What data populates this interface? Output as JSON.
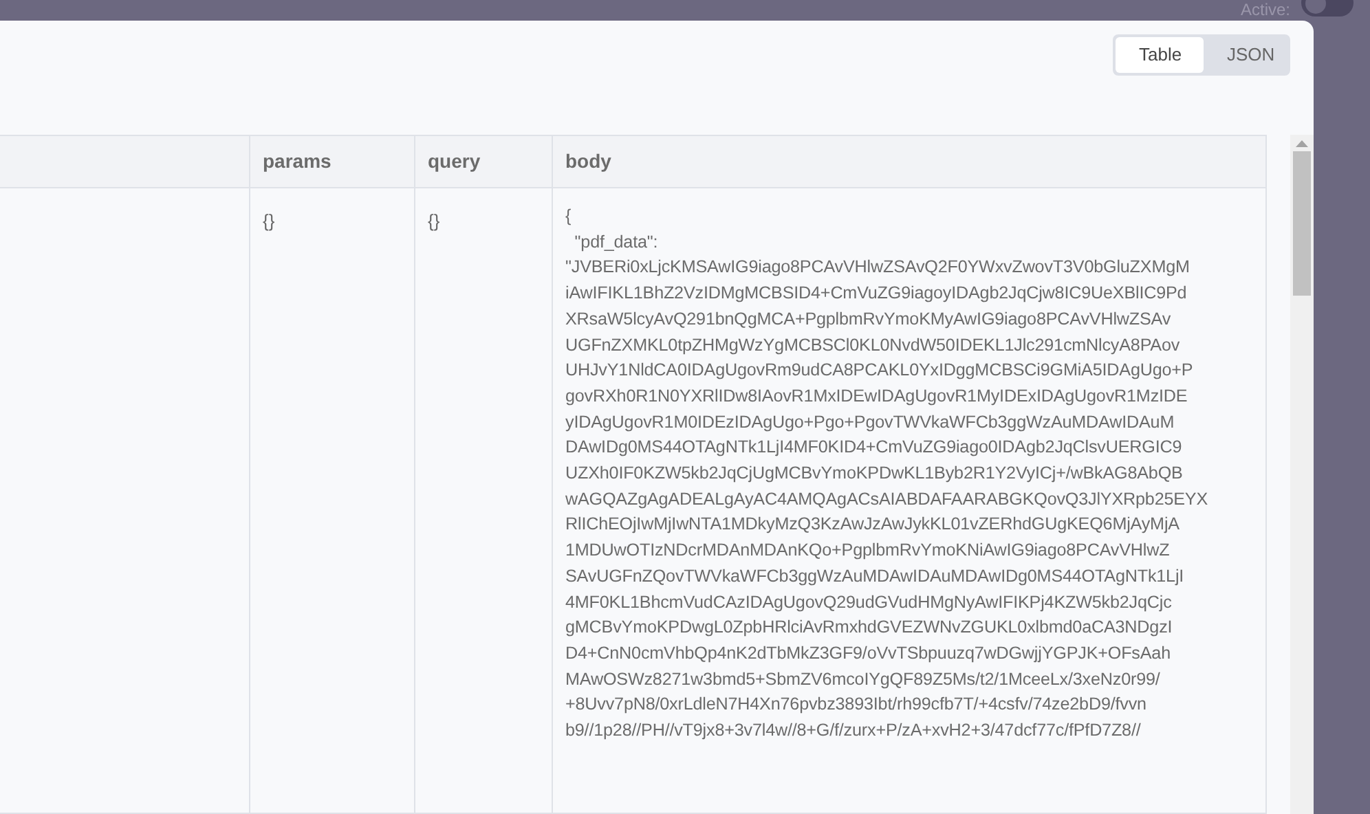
{
  "active_switch": {
    "label": "Active:",
    "on": false
  },
  "view_tabs": [
    {
      "label": "Table",
      "selected": true
    },
    {
      "label": "JSON",
      "selected": false
    }
  ],
  "table": {
    "columns": [
      "params",
      "query",
      "body"
    ],
    "rows": [
      {
        "params": "{}",
        "query": "{}",
        "body": [
          "{",
          "  \"pdf_data\":",
          "\"JVBERi0xLjcKMSAwIG9iago8PCAvVHlwZSAvQ2F0YWxvZwovT3V0bGluZXMgM",
          "iAwIFIKL1BhZ2VzIDMgMCBSID4+CmVuZG9iagoyIDAgb2JqCjw8IC9UeXBlIC9Pd",
          "XRsaW5lcyAvQ291bnQgMCA+PgplbmRvYmoKMyAwIG9iago8PCAvVHlwZSAv",
          "UGFnZXMKL0tpZHMgWzYgMCBSCl0KL0NvdW50IDEKL1Jlc291cmNlcyA8PAov",
          "UHJvY1NldCA0IDAgUgovRm9udCA8PCAKL0YxIDggMCBSCi9GMiA5IDAgUgo+P",
          "govRXh0R1N0YXRlIDw8IAovR1MxIDEwIDAgUgovR1MyIDExIDAgUgovR1MzIDE",
          "yIDAgUgovR1M0IDEzIDAgUgo+Pgo+PgovTWVkaWFCb3ggWzAuMDAwIDAuM",
          "DAwIDg0MS44OTAgNTk1LjI4MF0KID4+CmVuZG9iago0IDAgb2JqClsvUERGIC9",
          "UZXh0IF0KZW5kb2JqCjUgMCBvYmoKPDwKL1Byb2R1Y2VyICj+/wBkAG8AbQB",
          "wAGQAZgAgADEALgAyAC4AMQAgACsAIABDAFAARABGKQovQ3JlYXRpb25EYX",
          "RlIChEOjIwMjIwNTA1MDkyMzQ3KzAwJzAwJykKL01vZERhdGUgKEQ6MjAyMjA",
          "1MDUwOTIzNDcrMDAnMDAnKQo+PgplbmRvYmoKNiAwIG9iago8PCAvVHlwZ",
          "SAvUGFnZQovTWVkaWFCb3ggWzAuMDAwIDAuMDAwIDg0MS44OTAgNTk1LjI",
          "4MF0KL1BhcmVudCAzIDAgUgovQ29udGVudHMgNyAwIFIKPj4KZW5kb2JqCjc",
          "gMCBvYmoKPDwgL0ZpbHRlciAvRmxhdGVEZWNvZGUKL0xlbmd0aCA3NDgzI",
          "D4+CnN0cmVhbQp4nK2dTbMkZ3GF9/oVvTSbpuuzq7wDGwjjYGPJK+OFsAah",
          "MAwOSWz8271w3bmd5+SbmZV6mcoIYgQF89Z5Ms/t2/1MceeLx/3xeNz0r99/",
          "+8Uvv7pN8/0xrLdleN7H4Xn76pvbz3893Ibt/rh99cfb7T/+4csfv/74ze2bD9/fvvn",
          "b9//1p28//PH//vT9jx8+3v7l4w//8+G/f/zurx+P/zA+xvH2+3/47dcf77c/fPfD7Z8//"
        ]
      }
    ]
  }
}
